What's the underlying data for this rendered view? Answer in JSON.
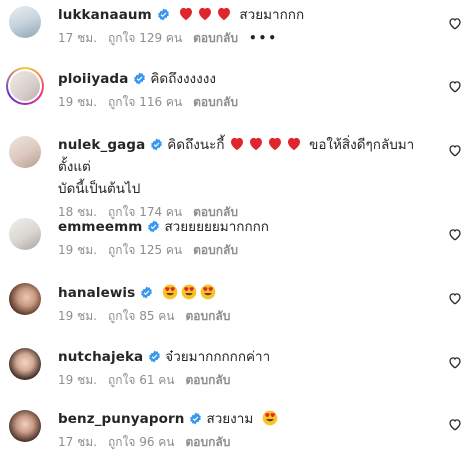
{
  "comments": [
    {
      "username": "lukkanaaum",
      "text_before": "",
      "text": "สวยมากกก",
      "time": "17 ชม.",
      "likes": "ถูกใจ 129 คน",
      "reply": "ตอบกลับ",
      "more": "•••",
      "hearts": 3,
      "faces": 0
    },
    {
      "username": "ploiiyada",
      "text_before": "",
      "text": "คิดถึงงงงงง",
      "time": "19 ชม.",
      "likes": "ถูกใจ 116 คน",
      "reply": "ตอบกลับ",
      "hearts": 0,
      "faces": 0
    },
    {
      "username": "nulek_gaga",
      "text_before": "คิดถึงนะกี้",
      "text": "ขอให้สิ่งดีๆกลับมาตั้งแต่",
      "text2": "บัดนี้เป็นต้นไป",
      "time": "18 ชม.",
      "likes": "ถูกใจ 174 คน",
      "reply": "ตอบกลับ",
      "hearts": 4,
      "faces": 0
    },
    {
      "username": "emmeemm",
      "text_before": "",
      "text": "สวยยยยยมากกกก",
      "time": "19 ชม.",
      "likes": "ถูกใจ 125 คน",
      "reply": "ตอบกลับ",
      "hearts": 0,
      "faces": 0
    },
    {
      "username": "hanalewis",
      "text_before": "",
      "text": "",
      "time": "19 ชม.",
      "likes": "ถูกใจ 85 คน",
      "reply": "ตอบกลับ",
      "hearts": 0,
      "faces": 3
    },
    {
      "username": "nutchajeka",
      "text_before": "",
      "text": "จ๋วยมากกกกกค่าา",
      "time": "19 ชม.",
      "likes": "ถูกใจ 61 คน",
      "reply": "ตอบกลับ",
      "hearts": 0,
      "faces": 0
    },
    {
      "username": "benz_punyaporn",
      "text_before": "",
      "text": "สวยงาม",
      "time": "17 ชม.",
      "likes": "ถูกใจ 96 คน",
      "reply": "ตอบกลับ",
      "hearts": 0,
      "faces": 1
    }
  ],
  "colors": {
    "verified": "#3897f0",
    "heart_emoji": "#e0262d",
    "meta": "#8e8e8e",
    "face": "#f7c325"
  },
  "icons": {
    "verified": "verified-badge-icon",
    "like": "heart-outline-icon",
    "heart": "red-heart-emoji",
    "face": "heart-eyes-emoji",
    "more": "more-options-icon"
  }
}
